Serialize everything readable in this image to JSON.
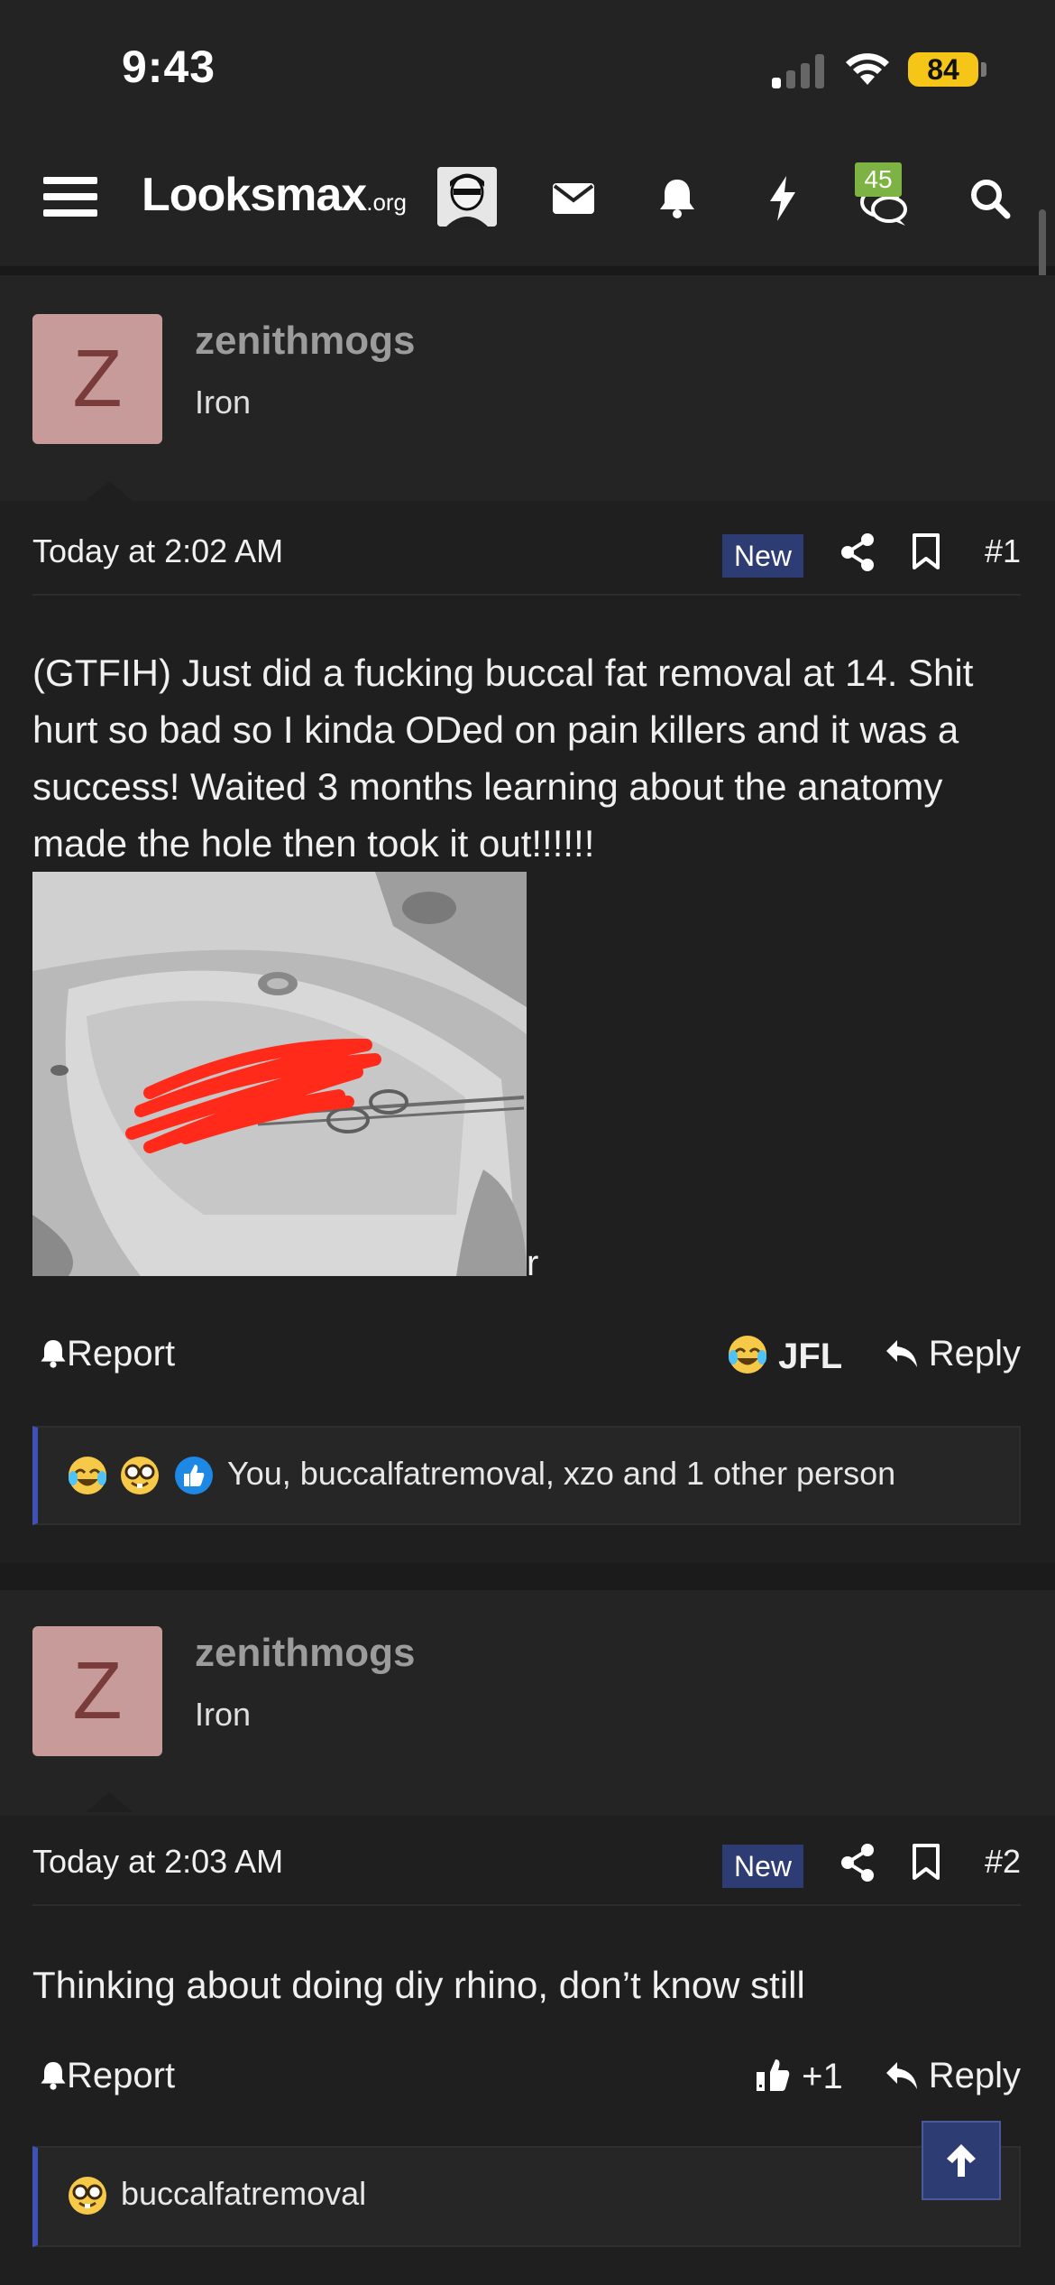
{
  "status_bar": {
    "time": "9:43",
    "battery": "84",
    "colors": {
      "battery": "#f5c518"
    }
  },
  "nav": {
    "logo_main": "Looksmax",
    "logo_suffix": ".org",
    "chat_badge": "45",
    "icons": [
      "menu-icon",
      "avatar",
      "mail-icon",
      "bell-icon",
      "bolt-icon",
      "chat-icon",
      "search-icon"
    ]
  },
  "posts": [
    {
      "avatar_letter": "Z",
      "username": "zenithmogs",
      "rank": "Iron",
      "date": "Today at 2:02 AM",
      "new_label": "New",
      "number": "#1",
      "body": "(GTFIH) Just did a fucking buccal fat removal at 14. Shit hurt so bad so I kinda ODed on pain killers and it was a success! Waited 3 months learning about the anatomy made the hole then took it out!!!!!!",
      "image_trailing_text": "r",
      "report_label": "Report",
      "reaction_label": "JFL",
      "reply_label": "Reply",
      "reactions_summary": "You, buccalfatremoval, xzo and 1 other person"
    },
    {
      "avatar_letter": "Z",
      "username": "zenithmogs",
      "rank": "Iron",
      "date": "Today at 2:03 AM",
      "new_label": "New",
      "number": "#2",
      "body": "Thinking about doing diy rhino, don’t know still",
      "report_label": "Report",
      "reaction_label": "+1",
      "reply_label": "Reply",
      "reactions_summary": "buccalfatremoval"
    }
  ],
  "colors": {
    "background": "#1f1f1f",
    "new_badge": "#2d3c73",
    "accent_border": "#3f51b5",
    "avatar_bg": "#c89b9b",
    "chat_badge": "#7cb342"
  }
}
